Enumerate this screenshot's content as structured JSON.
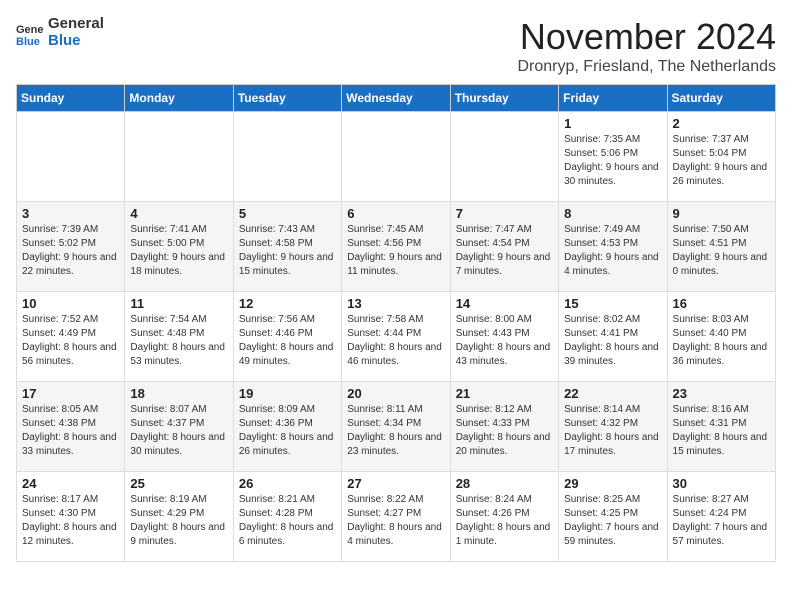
{
  "logo": {
    "general": "General",
    "blue": "Blue"
  },
  "title": "November 2024",
  "location": "Dronryp, Friesland, The Netherlands",
  "weekdays": [
    "Sunday",
    "Monday",
    "Tuesday",
    "Wednesday",
    "Thursday",
    "Friday",
    "Saturday"
  ],
  "weeks": [
    [
      {
        "day": "",
        "info": ""
      },
      {
        "day": "",
        "info": ""
      },
      {
        "day": "",
        "info": ""
      },
      {
        "day": "",
        "info": ""
      },
      {
        "day": "",
        "info": ""
      },
      {
        "day": "1",
        "info": "Sunrise: 7:35 AM\nSunset: 5:06 PM\nDaylight: 9 hours and 30 minutes."
      },
      {
        "day": "2",
        "info": "Sunrise: 7:37 AM\nSunset: 5:04 PM\nDaylight: 9 hours and 26 minutes."
      }
    ],
    [
      {
        "day": "3",
        "info": "Sunrise: 7:39 AM\nSunset: 5:02 PM\nDaylight: 9 hours and 22 minutes."
      },
      {
        "day": "4",
        "info": "Sunrise: 7:41 AM\nSunset: 5:00 PM\nDaylight: 9 hours and 18 minutes."
      },
      {
        "day": "5",
        "info": "Sunrise: 7:43 AM\nSunset: 4:58 PM\nDaylight: 9 hours and 15 minutes."
      },
      {
        "day": "6",
        "info": "Sunrise: 7:45 AM\nSunset: 4:56 PM\nDaylight: 9 hours and 11 minutes."
      },
      {
        "day": "7",
        "info": "Sunrise: 7:47 AM\nSunset: 4:54 PM\nDaylight: 9 hours and 7 minutes."
      },
      {
        "day": "8",
        "info": "Sunrise: 7:49 AM\nSunset: 4:53 PM\nDaylight: 9 hours and 4 minutes."
      },
      {
        "day": "9",
        "info": "Sunrise: 7:50 AM\nSunset: 4:51 PM\nDaylight: 9 hours and 0 minutes."
      }
    ],
    [
      {
        "day": "10",
        "info": "Sunrise: 7:52 AM\nSunset: 4:49 PM\nDaylight: 8 hours and 56 minutes."
      },
      {
        "day": "11",
        "info": "Sunrise: 7:54 AM\nSunset: 4:48 PM\nDaylight: 8 hours and 53 minutes."
      },
      {
        "day": "12",
        "info": "Sunrise: 7:56 AM\nSunset: 4:46 PM\nDaylight: 8 hours and 49 minutes."
      },
      {
        "day": "13",
        "info": "Sunrise: 7:58 AM\nSunset: 4:44 PM\nDaylight: 8 hours and 46 minutes."
      },
      {
        "day": "14",
        "info": "Sunrise: 8:00 AM\nSunset: 4:43 PM\nDaylight: 8 hours and 43 minutes."
      },
      {
        "day": "15",
        "info": "Sunrise: 8:02 AM\nSunset: 4:41 PM\nDaylight: 8 hours and 39 minutes."
      },
      {
        "day": "16",
        "info": "Sunrise: 8:03 AM\nSunset: 4:40 PM\nDaylight: 8 hours and 36 minutes."
      }
    ],
    [
      {
        "day": "17",
        "info": "Sunrise: 8:05 AM\nSunset: 4:38 PM\nDaylight: 8 hours and 33 minutes."
      },
      {
        "day": "18",
        "info": "Sunrise: 8:07 AM\nSunset: 4:37 PM\nDaylight: 8 hours and 30 minutes."
      },
      {
        "day": "19",
        "info": "Sunrise: 8:09 AM\nSunset: 4:36 PM\nDaylight: 8 hours and 26 minutes."
      },
      {
        "day": "20",
        "info": "Sunrise: 8:11 AM\nSunset: 4:34 PM\nDaylight: 8 hours and 23 minutes."
      },
      {
        "day": "21",
        "info": "Sunrise: 8:12 AM\nSunset: 4:33 PM\nDaylight: 8 hours and 20 minutes."
      },
      {
        "day": "22",
        "info": "Sunrise: 8:14 AM\nSunset: 4:32 PM\nDaylight: 8 hours and 17 minutes."
      },
      {
        "day": "23",
        "info": "Sunrise: 8:16 AM\nSunset: 4:31 PM\nDaylight: 8 hours and 15 minutes."
      }
    ],
    [
      {
        "day": "24",
        "info": "Sunrise: 8:17 AM\nSunset: 4:30 PM\nDaylight: 8 hours and 12 minutes."
      },
      {
        "day": "25",
        "info": "Sunrise: 8:19 AM\nSunset: 4:29 PM\nDaylight: 8 hours and 9 minutes."
      },
      {
        "day": "26",
        "info": "Sunrise: 8:21 AM\nSunset: 4:28 PM\nDaylight: 8 hours and 6 minutes."
      },
      {
        "day": "27",
        "info": "Sunrise: 8:22 AM\nSunset: 4:27 PM\nDaylight: 8 hours and 4 minutes."
      },
      {
        "day": "28",
        "info": "Sunrise: 8:24 AM\nSunset: 4:26 PM\nDaylight: 8 hours and 1 minute."
      },
      {
        "day": "29",
        "info": "Sunrise: 8:25 AM\nSunset: 4:25 PM\nDaylight: 7 hours and 59 minutes."
      },
      {
        "day": "30",
        "info": "Sunrise: 8:27 AM\nSunset: 4:24 PM\nDaylight: 7 hours and 57 minutes."
      }
    ]
  ]
}
